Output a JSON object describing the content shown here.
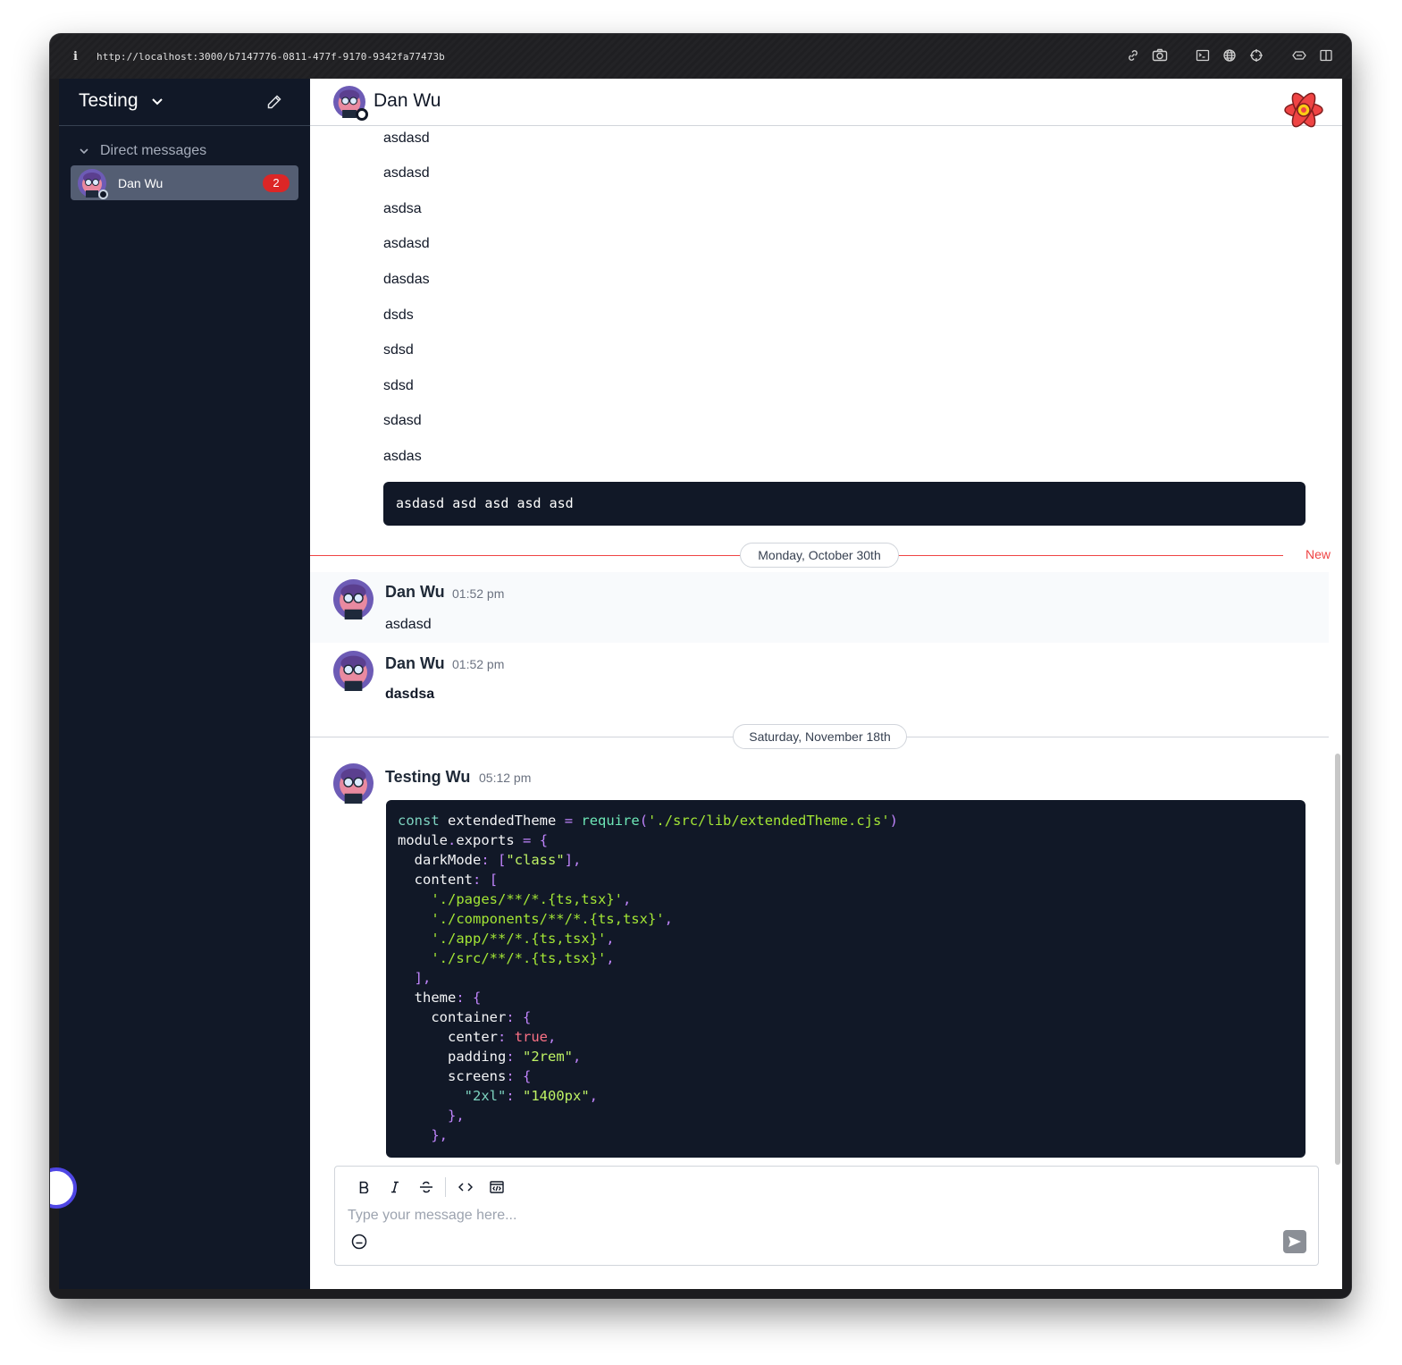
{
  "browser": {
    "info_icon": "i",
    "url": "http://localhost:3000/b7147776-0811-477f-9170-9342fa77473b",
    "tools": [
      "link-icon",
      "camera-icon",
      "terminal-icon",
      "globe-icon",
      "crosshair-icon",
      "extension-icon",
      "sidebar-icon"
    ]
  },
  "sidebar": {
    "workspace_name": "Testing",
    "section_label": "Direct messages",
    "items": [
      {
        "name": "Dan Wu",
        "unread": "2"
      }
    ]
  },
  "chat": {
    "title": "Dan Wu",
    "earlier_lines": [
      "asdasd",
      "asdasd",
      "asdsa",
      "asdasd",
      "dasdas",
      "dsds",
      "sdsd",
      "sdsd",
      "sdasd",
      "asdas"
    ],
    "inline_code": "asdasd asd asd asd asd",
    "divider_1": {
      "date": "Monday, October 30th",
      "new_label": "New"
    },
    "messages": [
      {
        "author": "Dan Wu",
        "time": "01:52 pm",
        "text": "asdasd"
      },
      {
        "author": "Dan Wu",
        "time": "01:52 pm",
        "text": "dasdsa"
      },
      {
        "author": "Testing Wu",
        "time": "05:12 pm"
      }
    ],
    "divider_2": {
      "date": "Saturday, November 18th"
    },
    "code_lines": [
      "const extendedTheme = require('./src/lib/extendedTheme.cjs')",
      "module.exports = {",
      "  darkMode: [\"class\"],",
      "  content: [",
      "    './pages/**/*.{ts,tsx}',",
      "    './components/**/*.{ts,tsx}',",
      "    './app/**/*.{ts,tsx}',",
      "    './src/**/*.{ts,tsx}',",
      "  ],",
      "  theme: {",
      "    container: {",
      "      center: true,",
      "      padding: \"2rem\",",
      "      screens: {",
      "        \"2xl\": \"1400px\",",
      "      },",
      "    },"
    ]
  },
  "composer": {
    "placeholder": "Type your message here...",
    "tools": [
      "bold-icon",
      "italic-icon",
      "strikethrough-icon",
      "code-icon",
      "code-block-icon"
    ]
  },
  "colors": {
    "sidebar_bg": "#111827",
    "active_item_bg": "#545e73",
    "badge": "#dc2626",
    "new_divider": "#ef4444"
  }
}
